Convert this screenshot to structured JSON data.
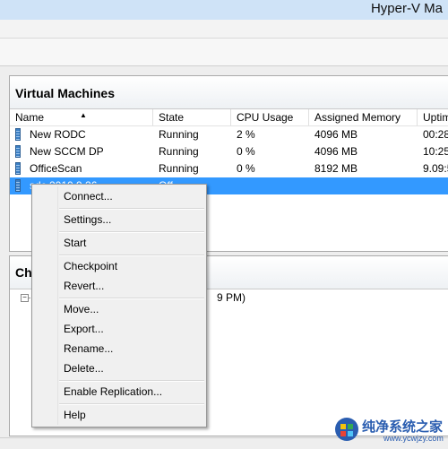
{
  "window": {
    "title": "Hyper-V Ma"
  },
  "vm_panel": {
    "title": "Virtual Machines",
    "columns": [
      "Name",
      "State",
      "CPU Usage",
      "Assigned Memory",
      "Uptim"
    ],
    "rows": [
      {
        "name": "New RODC",
        "state": "Running",
        "cpu": "2 %",
        "memory": "4096 MB",
        "uptime": "00:28:"
      },
      {
        "name": "New SCCM DP",
        "state": "Running",
        "cpu": "0 %",
        "memory": "4096 MB",
        "uptime": "10:25:"
      },
      {
        "name": "OfficeScan",
        "state": "Running",
        "cpu": "0 %",
        "memory": "8192 MB",
        "uptime": "9.09:5"
      },
      {
        "name": "sdc 2010 9 26",
        "state": "Off",
        "cpu": "",
        "memory": "",
        "uptime": ""
      }
    ]
  },
  "checkpoint_panel": {
    "title": "Ch",
    "tree_item": "9 PM)"
  },
  "context_menu": {
    "items": [
      "Connect...",
      "Settings...",
      "Start",
      "Checkpoint",
      "Revert...",
      "Move...",
      "Export...",
      "Rename...",
      "Delete...",
      "Enable Replication...",
      "Help"
    ]
  },
  "watermark": {
    "text": "纯净系统之家",
    "url": "www.ycwjzy.com"
  },
  "colors": {
    "selection": "#3399ff",
    "titlebar": "#cfe3f7",
    "watermark": "#2a5db0"
  },
  "icons": {
    "vm": "vm-icon",
    "sort": "sort-ascending-icon",
    "tree": "tree-expander-icon"
  }
}
